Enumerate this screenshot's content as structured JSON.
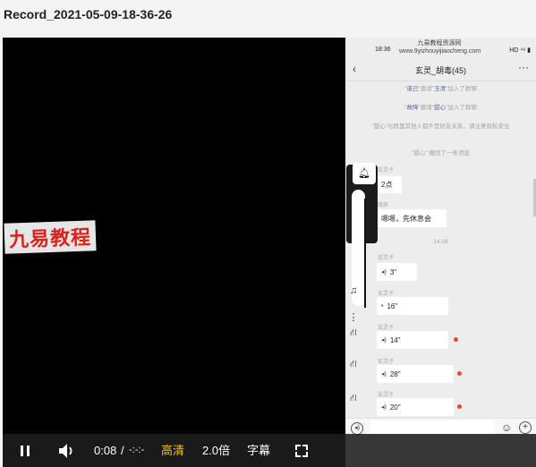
{
  "window": {
    "title": "Record_2021-05-09-18-36-26"
  },
  "video": {
    "watermark_text": "九易教程"
  },
  "phone": {
    "status_time": "18:36",
    "status_watermark_line1": "九易教程资源网",
    "status_watermark_line2": "www.9yizhouyijiaocheng.com",
    "status_icons": "HD ⁴⁶ ▮",
    "chat_title": "玄灵_胡毒(45)",
    "system_messages": [
      {
        "pre": "",
        "a": "道己",
        "mid": "邀请",
        "b": "玉清",
        "post": "加入了群聊"
      },
      {
        "pre": "",
        "a": "故障",
        "mid": "邀请",
        "b": "甜心",
        "post": "加入了群聊"
      },
      {
        "pre": "",
        "a": "",
        "mid": "\"甜心\"与群里其他人都不是好友关系，请注意隐私安全",
        "b": "",
        "post": ""
      },
      {
        "pre": "",
        "a": "",
        "mid": "\"甜心\" 撤回了一条消息",
        "b": "",
        "post": ""
      }
    ],
    "messages": [
      {
        "sender": "玄灵子",
        "text": "2点"
      },
      {
        "sender": "微辰",
        "text": "嗯嗯，先休息会"
      }
    ],
    "time_divider": "14:06",
    "voice_messages": [
      {
        "sender": "玄灵子",
        "duration": "3\"",
        "unread": false
      },
      {
        "sender": "玄灵子",
        "duration": "16\"",
        "unread": false
      },
      {
        "sender": "玄灵子",
        "duration": "14\"",
        "unread": true
      },
      {
        "sender": "玄灵子",
        "duration": "28\"",
        "unread": true
      },
      {
        "sender": "玄灵子",
        "duration": "20\"",
        "unread": true
      }
    ]
  },
  "controls": {
    "time_current": "0:08",
    "time_separator": "/",
    "time_total": "-:-:-",
    "quality": "高清",
    "speed": "2.0倍",
    "subtitles": "字幕",
    "quality_color": "#f5c518"
  }
}
